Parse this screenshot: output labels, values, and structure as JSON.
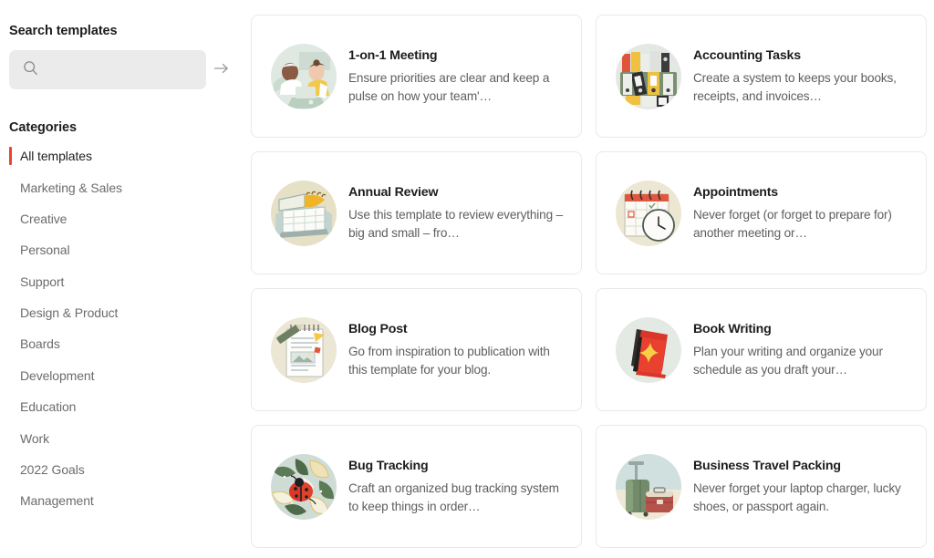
{
  "sidebar": {
    "search_heading": "Search templates",
    "search": {
      "value": "",
      "placeholder": "",
      "icon": "search-icon",
      "submit_icon": "arrow-right-icon"
    },
    "categories_heading": "Categories",
    "active_category": "All templates",
    "accent_color": "#e8442e",
    "items": [
      {
        "label": "All templates",
        "active": true
      },
      {
        "label": "Marketing & Sales",
        "active": false
      },
      {
        "label": "Creative",
        "active": false
      },
      {
        "label": "Personal",
        "active": false
      },
      {
        "label": "Support",
        "active": false
      },
      {
        "label": "Design & Product",
        "active": false
      },
      {
        "label": "Boards",
        "active": false
      },
      {
        "label": "Development",
        "active": false
      },
      {
        "label": "Education",
        "active": false
      },
      {
        "label": "Work",
        "active": false
      },
      {
        "label": "2022 Goals",
        "active": false
      },
      {
        "label": "Management",
        "active": false
      }
    ]
  },
  "templates": [
    {
      "title": "1-on-1 Meeting",
      "description": "Ensure priorities are clear and keep a pulse on how your team'…",
      "icon": "two-people-laptop-illustration",
      "bg": "#dfe9e2"
    },
    {
      "title": "Accounting Tasks",
      "description": "Create a system to keeps your books, receipts, and invoices…",
      "icon": "binders-shelf-illustration",
      "bg": "#e4e8e3"
    },
    {
      "title": "Annual Review",
      "description": "Use this template to review everything – big and small – fro…",
      "icon": "desk-calendar-illustration",
      "bg": "#e6e0c6"
    },
    {
      "title": "Appointments",
      "description": "Never forget (or forget to prepare for) another meeting or…",
      "icon": "calendar-clock-illustration",
      "bg": "#ece7d2"
    },
    {
      "title": "Blog Post",
      "description": "Go from inspiration to publication with this template for your blog.",
      "icon": "notepad-pencil-illustration",
      "bg": "#ece6d4"
    },
    {
      "title": "Book Writing",
      "description": "Plan your writing and organize your schedule as you draft your…",
      "icon": "red-book-sparkle-illustration",
      "bg": "#e3eae3"
    },
    {
      "title": "Bug Tracking",
      "description": "Craft an organized bug tracking system to keep things in order…",
      "icon": "ladybug-leaves-illustration",
      "bg": "#cfdcd6"
    },
    {
      "title": "Business Travel Packing",
      "description": "Never forget your laptop charger, lucky shoes, or passport again.",
      "icon": "suitcases-illustration",
      "bg": "#eee8d6"
    }
  ]
}
